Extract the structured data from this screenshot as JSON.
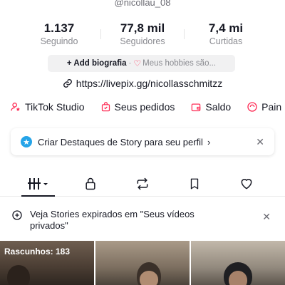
{
  "profile": {
    "handle": "@nicollau_08",
    "stats": [
      {
        "value": "1.137",
        "label": "Seguindo"
      },
      {
        "value": "77,8 mil",
        "label": "Seguidores"
      },
      {
        "value": "7,4 mi",
        "label": "Curtidas"
      }
    ],
    "bio": {
      "add_label": "+ Add biografia",
      "separator": "·",
      "hobbies_label": "Meus hobbies são..."
    },
    "link": "https://livepix.gg/nicollasschmitzz"
  },
  "quick_actions": [
    {
      "label": "TikTok Studio",
      "icon": "person-star-icon"
    },
    {
      "label": "Seus pedidos",
      "icon": "bag-icon"
    },
    {
      "label": "Saldo",
      "icon": "wallet-icon"
    },
    {
      "label": "Pain",
      "icon": "panel-icon"
    }
  ],
  "story_banner": {
    "text": "Criar Destaques de Story para seu perfil",
    "chevron": "›",
    "close": "✕"
  },
  "tabs": [
    {
      "name": "videos",
      "icon": "grid-icon",
      "active": true
    },
    {
      "name": "private",
      "icon": "lock-icon",
      "active": false
    },
    {
      "name": "reposts",
      "icon": "repost-icon",
      "active": false
    },
    {
      "name": "favorites",
      "icon": "bookmark-icon",
      "active": false
    },
    {
      "name": "liked",
      "icon": "heart-icon",
      "active": false
    }
  ],
  "notice": {
    "text": "Veja Stories expirados em \"Seus vídeos privados\"",
    "close": "✕"
  },
  "grid": {
    "drafts_label": "Rascunhos: 183"
  },
  "colors": {
    "accent_red": "#fe2c55",
    "text": "#161823",
    "muted": "#8a8b91",
    "story_blue": "#25a4e8"
  }
}
